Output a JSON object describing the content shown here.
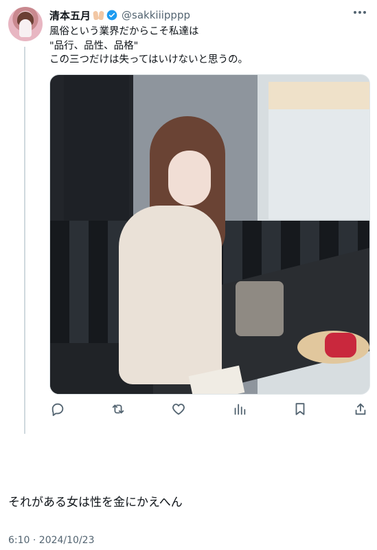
{
  "tweet": {
    "display_name": "清本五月",
    "handle": "@sakkiiipppp",
    "text": "風俗という業界だからこそ私達は\n\"品行、品性、品格\"\nこの三つだけは失ってはいけないと思うの。"
  },
  "reply": {
    "text": "それがある女は性を金にかえへん",
    "timestamp": "6:10 · 2024/10/23"
  },
  "actions": [
    "reply-icon",
    "retweet-icon",
    "like-icon",
    "views-icon",
    "bookmark-icon",
    "share-icon"
  ],
  "colors": {
    "verified": "#1d9bf0",
    "icon": "#536471",
    "thread_line": "#cfd9de"
  }
}
